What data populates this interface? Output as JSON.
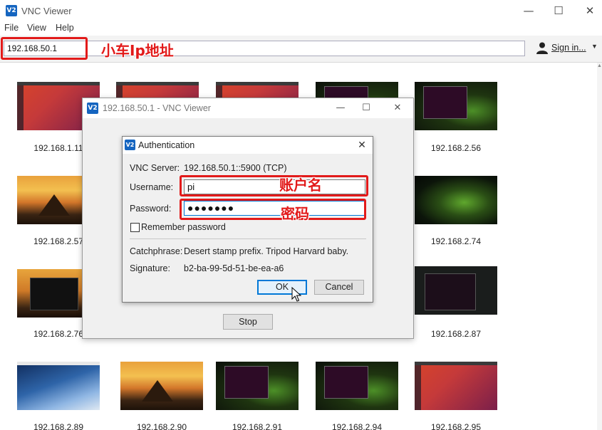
{
  "app": {
    "title": "VNC Viewer",
    "logo": "V2"
  },
  "window_controls": {
    "minimize": "—",
    "maximize": "☐",
    "close": "✕"
  },
  "menu": [
    "File",
    "View",
    "Help"
  ],
  "toolbar": {
    "address_value": "192.168.50.1",
    "signin_label": "Sign in...",
    "signin_caret": "▼"
  },
  "annotations": {
    "address_note": "小车Ip地址",
    "username_note": "账户名",
    "password_note": "密码",
    "color": "#e21a1a"
  },
  "thumbnails": [
    {
      "label": "192.168.1.11",
      "style": "ubuntu"
    },
    {
      "label": "",
      "style": "ubuntu"
    },
    {
      "label": "",
      "style": "ubuntu"
    },
    {
      "label": "",
      "style": "term-green"
    },
    {
      "label": "192.168.2.56",
      "style": "term-green"
    },
    {
      "label": "192.168.2.57",
      "style": "sunset"
    },
    {
      "label": "192.168.2.74",
      "style": "green"
    },
    {
      "label": "192.168.2.76",
      "style": "sunset-term"
    },
    {
      "label": "192.168.2.87",
      "style": "terminal-dark"
    },
    {
      "label": "192.168.2.89",
      "style": "rpi"
    },
    {
      "label": "192.168.2.90",
      "style": "sunset"
    },
    {
      "label": "192.168.2.91",
      "style": "term-green"
    },
    {
      "label": "192.168.2.94",
      "style": "term-green"
    },
    {
      "label": "192.168.2.95",
      "style": "ubuntu"
    }
  ],
  "child_window": {
    "title": "192.168.50.1 - VNC Viewer",
    "stop_label": "Stop"
  },
  "auth": {
    "title": "Authentication",
    "server_label": "VNC Server:",
    "server_value": "192.168.50.1::5900 (TCP)",
    "username_label": "Username:",
    "username_value": "pi",
    "password_label": "Password:",
    "password_value": "●●●●●●●",
    "remember_label": "Remember password",
    "catchphrase_label": "Catchphrase:",
    "catchphrase_value": "Desert stamp prefix. Tripod Harvard baby.",
    "signature_label": "Signature:",
    "signature_value": "b2-ba-99-5d-51-be-ea-a6",
    "ok_label": "OK",
    "cancel_label": "Cancel"
  }
}
